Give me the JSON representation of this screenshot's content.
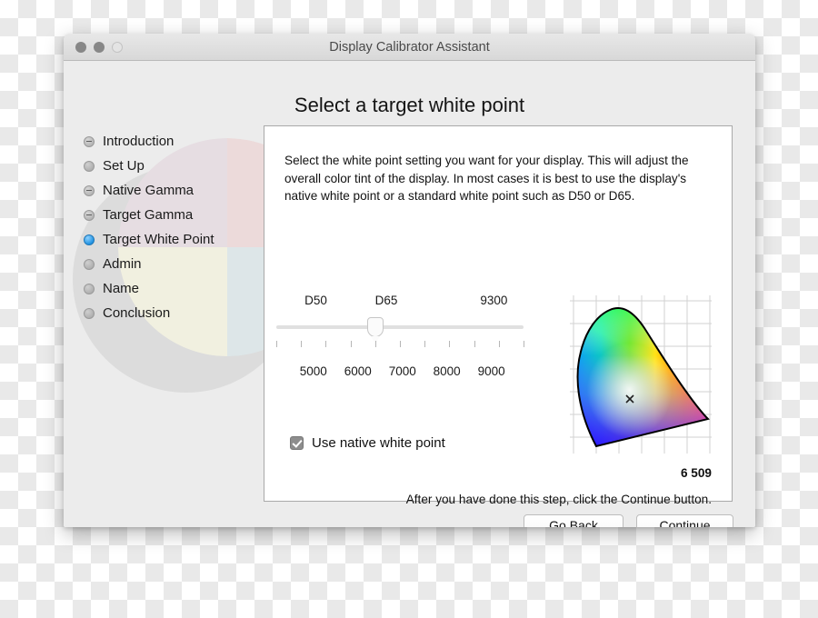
{
  "window": {
    "title": "Display Calibrator Assistant",
    "traffic_lights": [
      "close",
      "minimize",
      "zoom"
    ]
  },
  "heading": "Select a target white point",
  "sidebar": {
    "items": [
      {
        "label": "Introduction",
        "state": "done"
      },
      {
        "label": "Set Up",
        "state": "todo"
      },
      {
        "label": "Native Gamma",
        "state": "done"
      },
      {
        "label": "Target Gamma",
        "state": "done"
      },
      {
        "label": "Target White Point",
        "state": "current"
      },
      {
        "label": "Admin",
        "state": "todo"
      },
      {
        "label": "Name",
        "state": "todo"
      },
      {
        "label": "Conclusion",
        "state": "todo"
      }
    ]
  },
  "panel": {
    "intro_text": "Select the white point setting you want for your display.  This will adjust the overall color tint of the display.  In most cases it is best to use the display's native white point or a standard white point such as D50 or D65.",
    "slider": {
      "top_labels": [
        "D50",
        "D65",
        "9300"
      ],
      "bottom_labels": [
        "5000",
        "6000",
        "7000",
        "8000",
        "9000"
      ],
      "tick_count": 11,
      "thumb_tick_index": 4,
      "min": 4500,
      "max": 9500,
      "value": 6509
    },
    "checkbox": {
      "label": "Use native white point",
      "checked": true
    },
    "cie_diagram": {
      "marker": "x",
      "grid": true
    },
    "temperature_readout": "6 509",
    "footer_note": "After you have done this step, click the Continue button."
  },
  "buttons": {
    "go_back": "Go Back",
    "continue": "Continue"
  },
  "colors": {
    "accent": "#1b8fe0",
    "window_bg": "#ececec",
    "panel_bg": "#ffffff"
  }
}
